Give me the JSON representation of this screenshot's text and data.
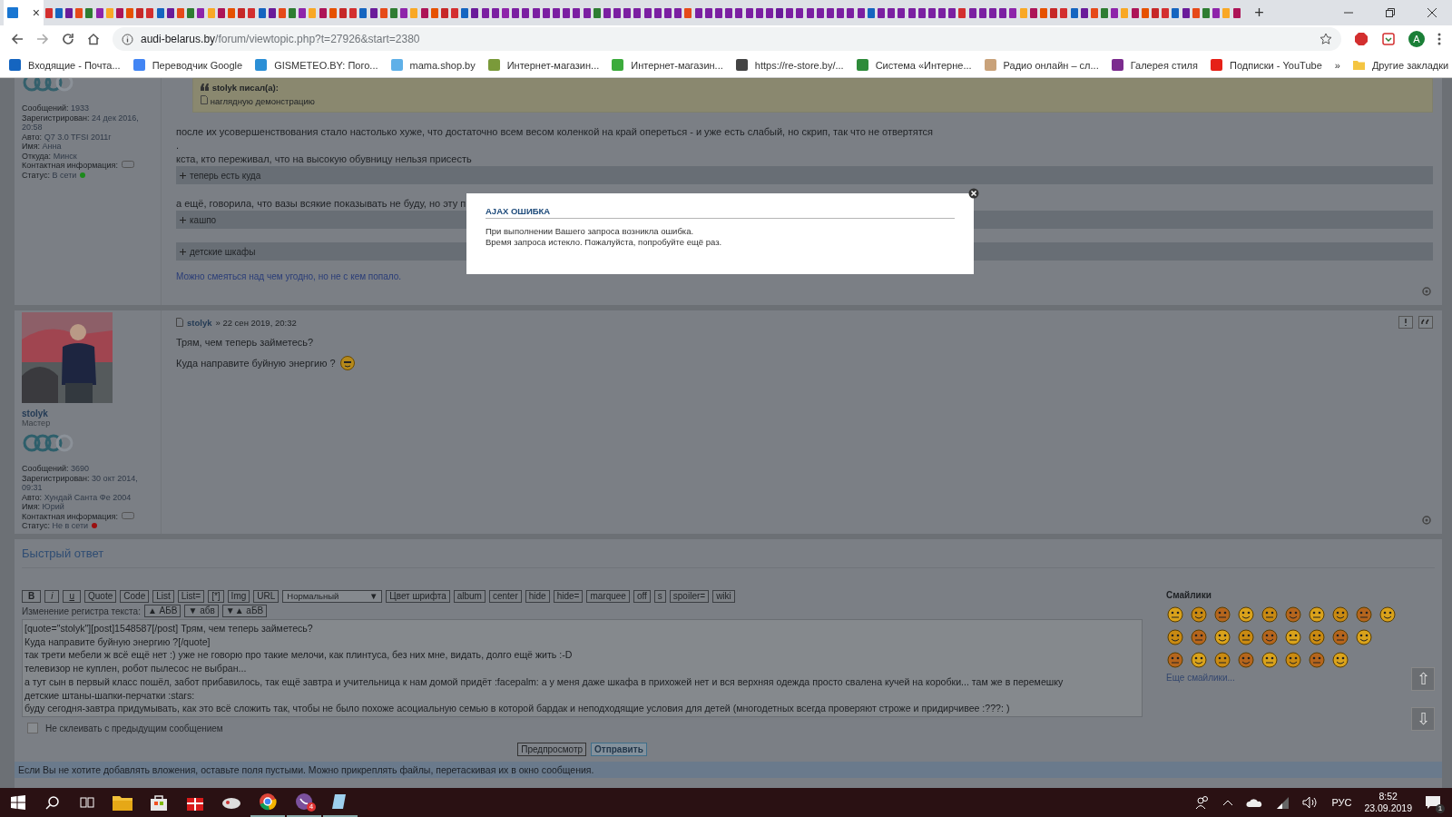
{
  "browser": {
    "active_tab_close": "×",
    "new_tab": "+",
    "url_host": "audi-belarus.by",
    "url_path": "/forum/viewtopic.php?t=27926&start=2380",
    "profile_initial": "A",
    "more_bookmarks": "»",
    "other_bookmarks": "Другие закладки",
    "bookmarks": [
      {
        "label": "Входящие - Почта...",
        "color": "#1565c0"
      },
      {
        "label": "Переводчик Google",
        "color": "#4285f4"
      },
      {
        "label": "GISMETEO.BY: Пого...",
        "color": "#2b8fd6"
      },
      {
        "label": "mama.shop.by",
        "color": "#5fb0e8"
      },
      {
        "label": "Интернет-магазин...",
        "color": "#7a9a3a"
      },
      {
        "label": "Интернет-магазин...",
        "color": "#3cab3c"
      },
      {
        "label": "https://re-store.by/...",
        "color": "#444444"
      },
      {
        "label": "Система «Интерне...",
        "color": "#2e8b3a"
      },
      {
        "label": "Радио онлайн – сл...",
        "color": "#c9a27a"
      },
      {
        "label": "Галерея стиля",
        "color": "#7b2b8e"
      },
      {
        "label": "Подписки - YouTube",
        "color": "#e62117"
      }
    ]
  },
  "posts": [
    {
      "profile": {
        "kind": "partial",
        "stats": [
          {
            "label": "Сообщений:",
            "value": "1933"
          },
          {
            "label": "Зарегистрирован:",
            "value": "24 дек 2016, 20:58"
          },
          {
            "label": "Авто:",
            "value": "Q7 3.0 TFSI 2011г"
          },
          {
            "label": "Имя:",
            "value": "Анна"
          },
          {
            "label": "Откуда:",
            "value": "Минск"
          }
        ],
        "contact_label": "Контактная информация:",
        "status_label": "Статус:",
        "status": "В сети",
        "online": true
      },
      "quote": {
        "author": "stolyk писал(а):",
        "text": "наглядную демонстрацию"
      },
      "blocks": [
        {
          "kind": "text",
          "text": "после их усовершенствования стало настолько хуже, что достаточно всем весом коленкой на край опереться - и уже есть слабый, но скрип, так что не отвертятся"
        },
        {
          "kind": "text",
          "text": "."
        },
        {
          "kind": "text",
          "text": "кста, кто переживал, что на высокую обувницу нельзя присесть"
        },
        {
          "kind": "spoiler",
          "text": "теперь есть куда"
        },
        {
          "kind": "text",
          "text": "а ещё, говорила, что вазы всякие показывать не буду, но эту п"
        },
        {
          "kind": "spoiler",
          "text": "кашпо"
        },
        {
          "kind": "spoiler",
          "text": "детские шкафы"
        }
      ],
      "signature": "Можно смеяться над чем угодно, но не с кем попало."
    },
    {
      "profile": {
        "kind": "full",
        "name": "stolyk",
        "rank": "Мастер",
        "stats": [
          {
            "label": "Сообщений:",
            "value": "3690"
          },
          {
            "label": "Зарегистрирован:",
            "value": "30 окт 2014, 09:31"
          },
          {
            "label": "Авто:",
            "value": "Хундай Санта Фе 2004"
          },
          {
            "label": "Имя:",
            "value": "Юрий"
          }
        ],
        "contact_label": "Контактная информация:",
        "status_label": "Статус:",
        "status": "Не в сети",
        "online": false
      },
      "author": "stolyk",
      "date": "» 22 сен 2019, 20:32",
      "lines": [
        "Трям, чем теперь займетесь?",
        "Куда направите буйную энергию ?"
      ]
    }
  ],
  "quick_reply": {
    "title": "Быстрый ответ",
    "buttons_left": [
      "B",
      "i",
      "u",
      "Quote",
      "Code",
      "List",
      "List=",
      "[*]",
      "Img",
      "URL"
    ],
    "size_select": "Нормальный",
    "select_arrow": "▼",
    "buttons_right": [
      "Цвет шрифта",
      "album",
      "center",
      "hide",
      "hide=",
      "marquee",
      "off",
      "s",
      "spoiler=",
      "wiki"
    ],
    "case_label": "Изменение регистра текста:",
    "case_buttons": [
      "▲ АБВ",
      "▼ абв",
      "▼▲ аБВ"
    ],
    "message_lines": [
      "[quote=\"stolyk\"][post]1548587[/post] Трям, чем теперь займетесь?",
      "Куда направите буйную энергию ?[/quote]",
      "так трети мебели ж всё ещё нет  :)  уже не говорю про такие мелочи, как плинтуса, без них мне, видать, долго ещё жить  :-D",
      "телевизор не куплен, робот пылесос не выбран...",
      "а тут сын в первый класс пошёл, забот прибавилось, так ещё завтра и учительница к нам домой придёт  :facepalm:  а у меня даже шкафа в прихожей нет и вся верхняя одежда просто свалена кучей на коробки... там же в перемешку",
      "детские штаны-шапки-перчатки  :stars:",
      "буду сегодня-завтра придумывать, как это всё сложить так, чтобы не было похоже асоциальную семью в которой бардак и неподходящие условия для детей (многодетных всегда проверяют строже и придирчивее  :???:  )"
    ],
    "no_merge": {
      "label": "Не склеивать с предыдущим сообщением",
      "checked": false
    },
    "preview": "Предпросмотр",
    "submit": "Отправить",
    "smilies_title": "Смайлики",
    "more_smilies": "Еще смайлики...",
    "scroll_up": "⇧",
    "scroll_down": "⇩",
    "attachments_note": "Если Вы не хотите добавлять вложения, оставьте поля пустыми. Можно прикреплять файлы, перетаскивая их в окно сообщения."
  },
  "dialog": {
    "title": "AJAX ОШИБКА",
    "lines": [
      "При выполнении Вашего запроса возникла ошибка.",
      "Время запроса истекло. Пожалуйста, попробуйте ещё раз."
    ]
  },
  "taskbar": {
    "language": "РУС",
    "time": "8:52",
    "date": "23.09.2019",
    "notification_count": "1",
    "viber_badge": "4"
  }
}
